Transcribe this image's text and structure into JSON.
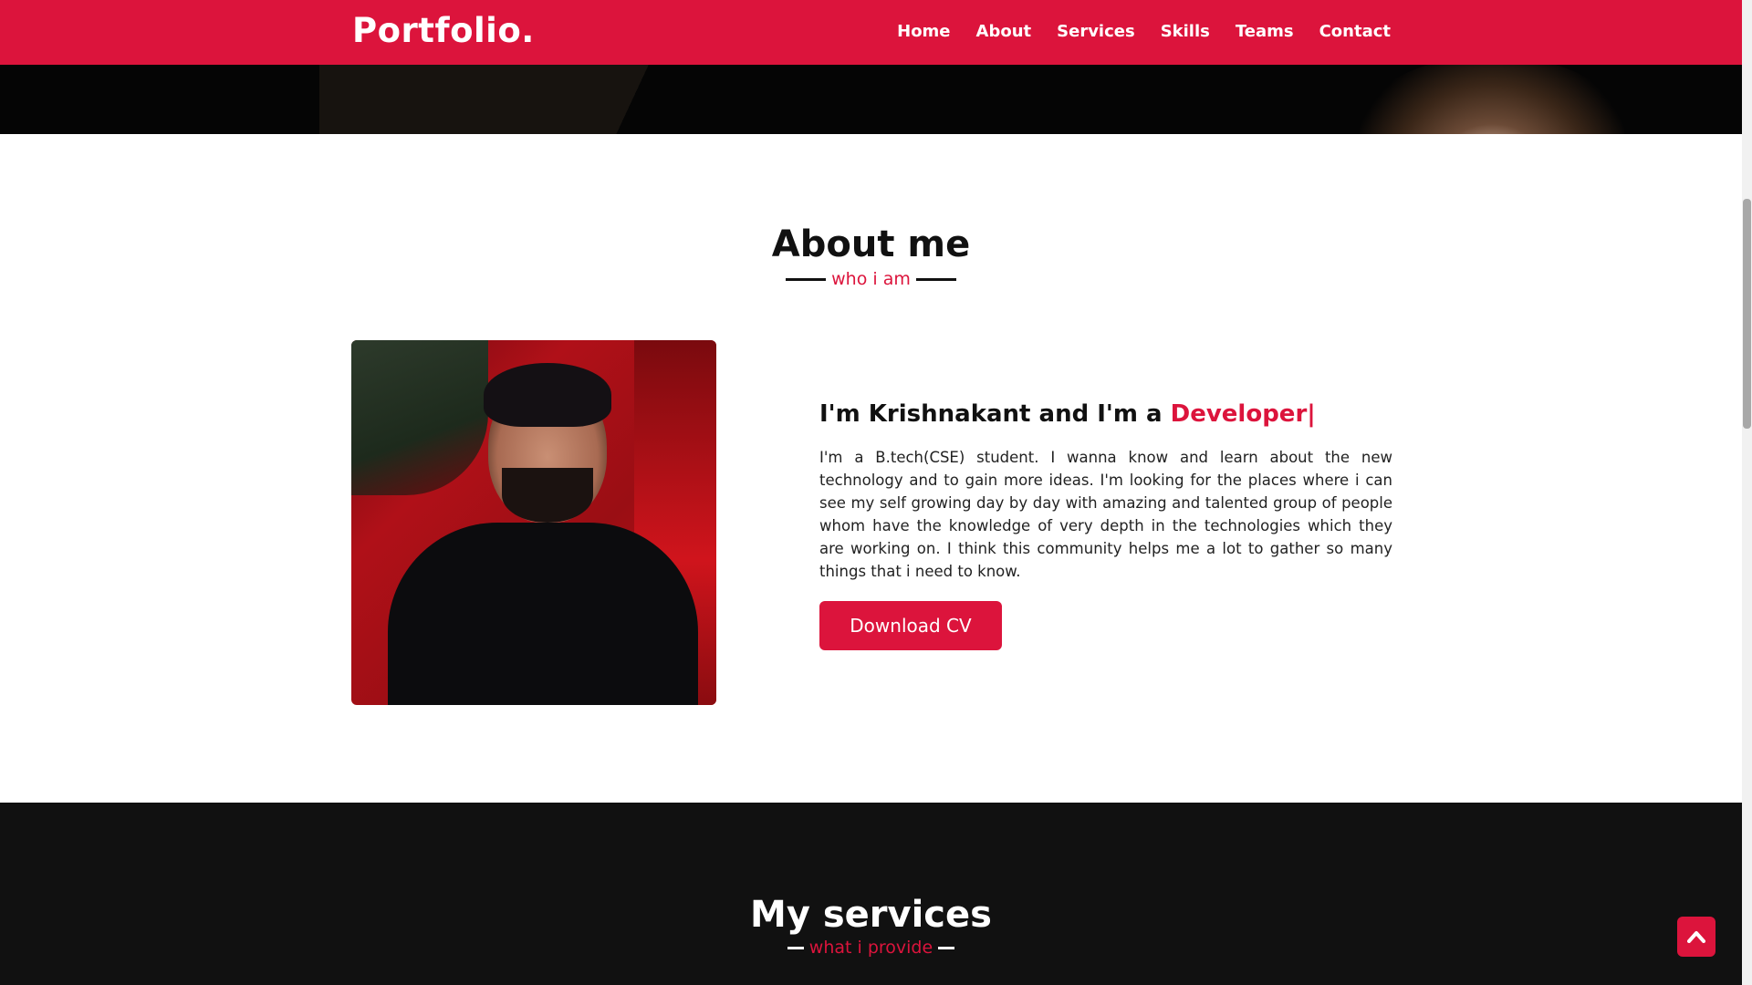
{
  "navbar": {
    "brand": "Portfolio.",
    "items": [
      {
        "label": "Home"
      },
      {
        "label": "About"
      },
      {
        "label": "Services"
      },
      {
        "label": "Skills"
      },
      {
        "label": "Teams"
      },
      {
        "label": "Contact"
      }
    ]
  },
  "about": {
    "title": "About me",
    "subtitle": "who i am",
    "intro_prefix": "I'm Krishnakant and I'm a ",
    "intro_role": "Developer|",
    "bio": "I'm a B.tech(CSE) student. I wanna know and learn about the new technology and to gain more ideas. I'm looking for the places where i can see my self growing day by day with amazing and talented group of people whom have the knowledge of very depth in the technologies which they are working on. I think this community helps me a lot to gather so many things that i need to know.",
    "cv_button": "Download CV"
  },
  "services": {
    "title": "My services",
    "subtitle": "what i provide"
  },
  "icons": {
    "back_to_top": "chevron-up-icon"
  },
  "colors": {
    "accent": "#dc143c",
    "dark_section": "#111111",
    "hero": "#050505"
  }
}
